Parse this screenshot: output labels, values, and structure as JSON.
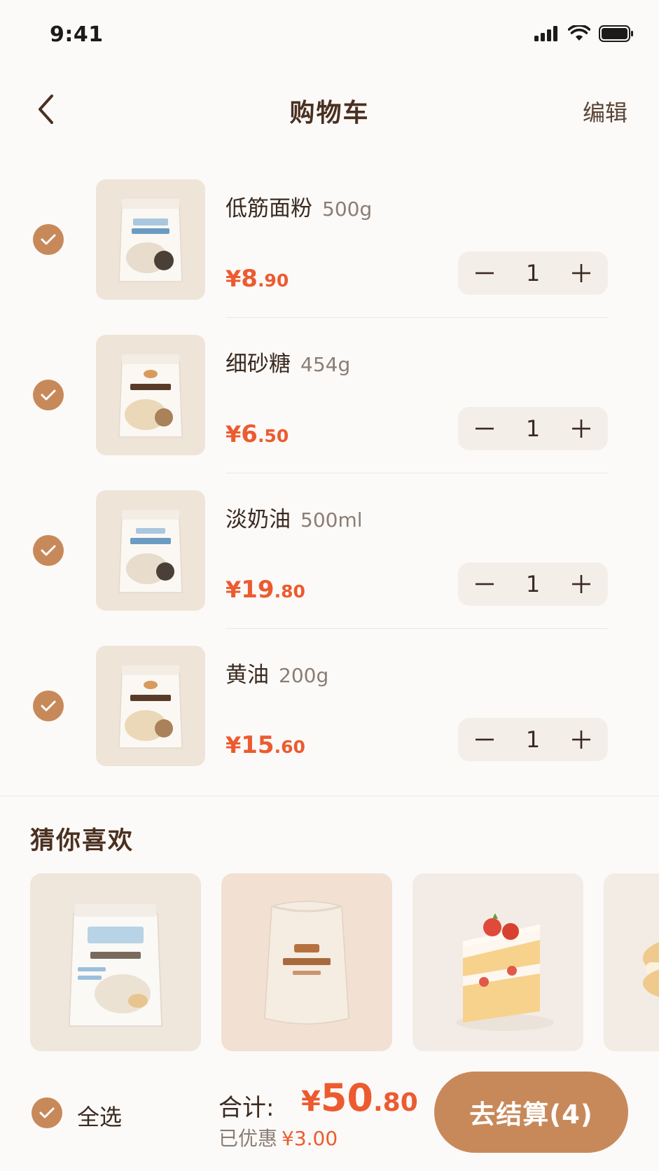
{
  "status_bar": {
    "time": "9:41"
  },
  "header": {
    "title": "购物车",
    "edit_label": "编辑"
  },
  "cart_items": [
    {
      "name": "低筋面粉",
      "spec": "500g",
      "currency": "¥",
      "price_int": "8",
      "price_dec": ".90",
      "quantity": "1",
      "checked": true
    },
    {
      "name": "细砂糖",
      "spec": "454g",
      "currency": "¥",
      "price_int": "6",
      "price_dec": ".50",
      "quantity": "1",
      "checked": true
    },
    {
      "name": "淡奶油",
      "spec": "500ml",
      "currency": "¥",
      "price_int": "19",
      "price_dec": ".80",
      "quantity": "1",
      "checked": true
    },
    {
      "name": "黄油",
      "spec": "200g",
      "currency": "¥",
      "price_int": "15",
      "price_dec": ".60",
      "quantity": "1",
      "checked": true
    }
  ],
  "recommend": {
    "title": "猜你喜欢",
    "cards": [
      {
        "icon": "milk-bag-icon"
      },
      {
        "icon": "sugar-sack-icon"
      },
      {
        "icon": "cake-slice-icon"
      },
      {
        "icon": "macaron-icon"
      }
    ]
  },
  "bottom_bar": {
    "select_all_label": "全选",
    "total_label": "合计:",
    "total_currency": "¥",
    "total_int": "50",
    "total_dec": ".80",
    "discount_label": "已优惠",
    "discount_value": "¥3.00",
    "checkout_label": "去结算(4)"
  },
  "colors": {
    "accent": "#c8895a",
    "price": "#ec5b30",
    "background": "#fcfaf8",
    "title": "#4a3020"
  }
}
